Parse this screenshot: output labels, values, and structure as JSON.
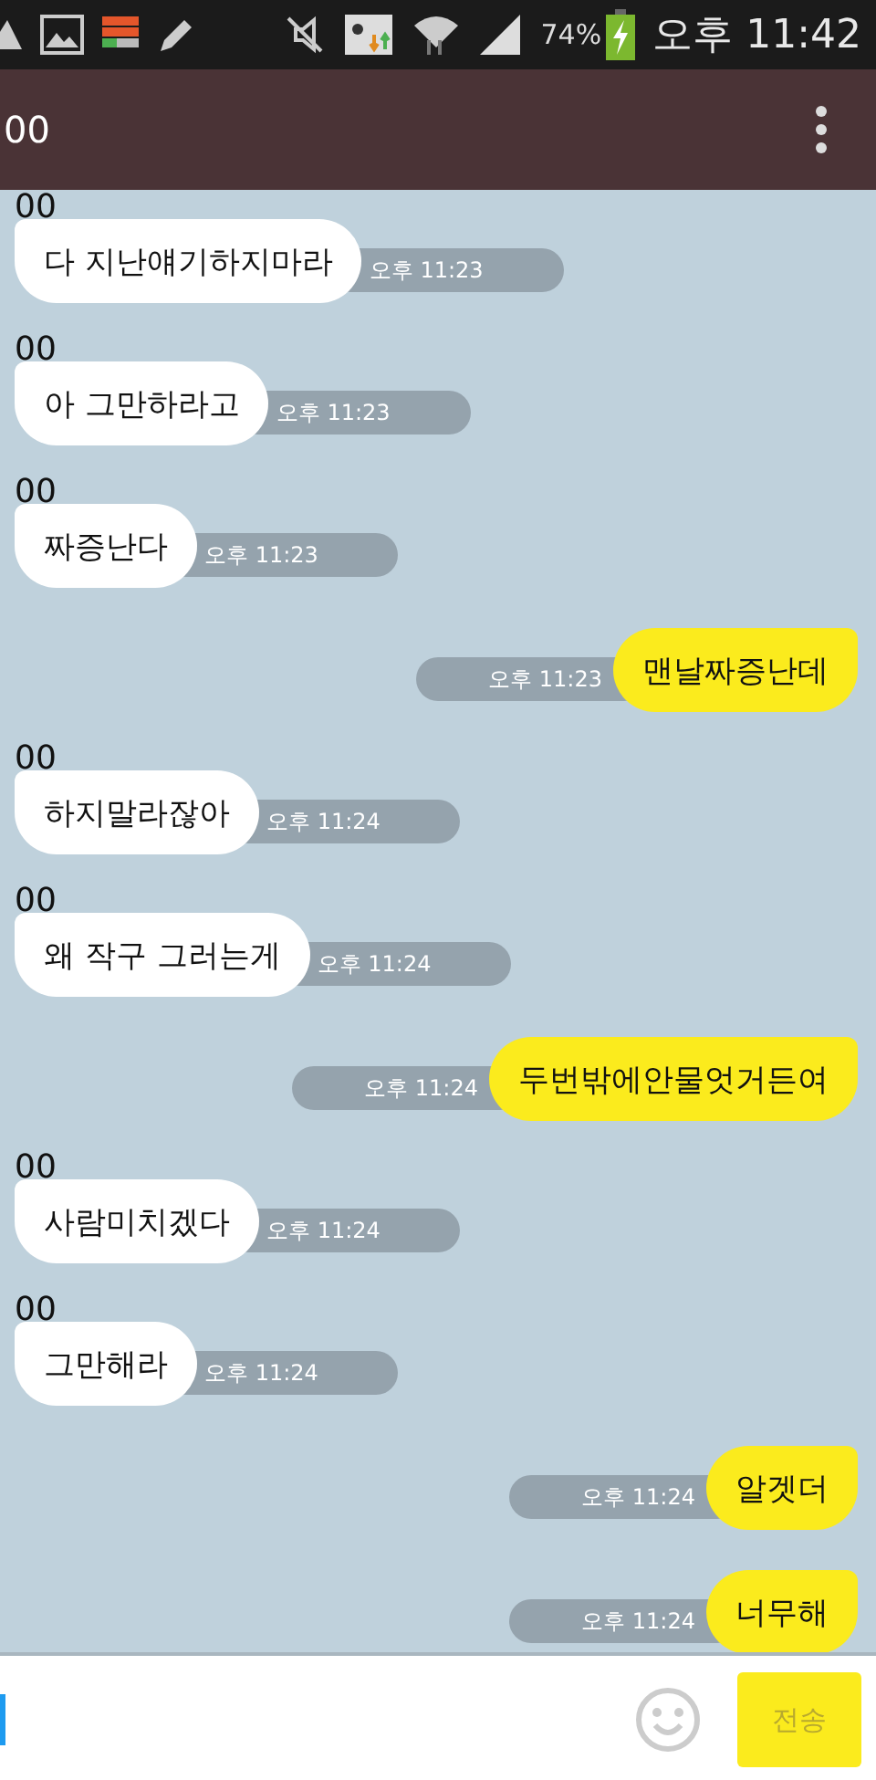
{
  "status_bar": {
    "battery_percent": "74%",
    "time": "오후 11:42"
  },
  "title_bar": {
    "title": "00"
  },
  "messages": [
    {
      "kind": "received",
      "sender": "00",
      "text": "다 지난얘기하지마라",
      "time": "오후 11:23"
    },
    {
      "kind": "received",
      "sender": "00",
      "text": "아 그만하라고",
      "time": "오후 11:23"
    },
    {
      "kind": "received",
      "sender": "00",
      "text": "짜증난다",
      "time": "오후 11:23"
    },
    {
      "kind": "sent",
      "text": "맨날짜증난데",
      "time": "오후 11:23"
    },
    {
      "kind": "received",
      "sender": "00",
      "text": "하지말라잖아",
      "time": "오후 11:24"
    },
    {
      "kind": "received",
      "sender": "00",
      "text": "왜 작구 그러는게",
      "time": "오후 11:24"
    },
    {
      "kind": "sent",
      "text": "두번밖에안물엇거든여",
      "time": "오후 11:24"
    },
    {
      "kind": "received",
      "sender": "00",
      "text": "사람미치겠다",
      "time": "오후 11:24"
    },
    {
      "kind": "received",
      "sender": "00",
      "text": "그만해라",
      "time": "오후 11:24"
    },
    {
      "kind": "sent",
      "text": "알겟더",
      "time": "오후 11:24"
    },
    {
      "kind": "sent",
      "text": "너무해",
      "time": "오후 11:24"
    }
  ],
  "input_bar": {
    "send_label": "전송"
  }
}
